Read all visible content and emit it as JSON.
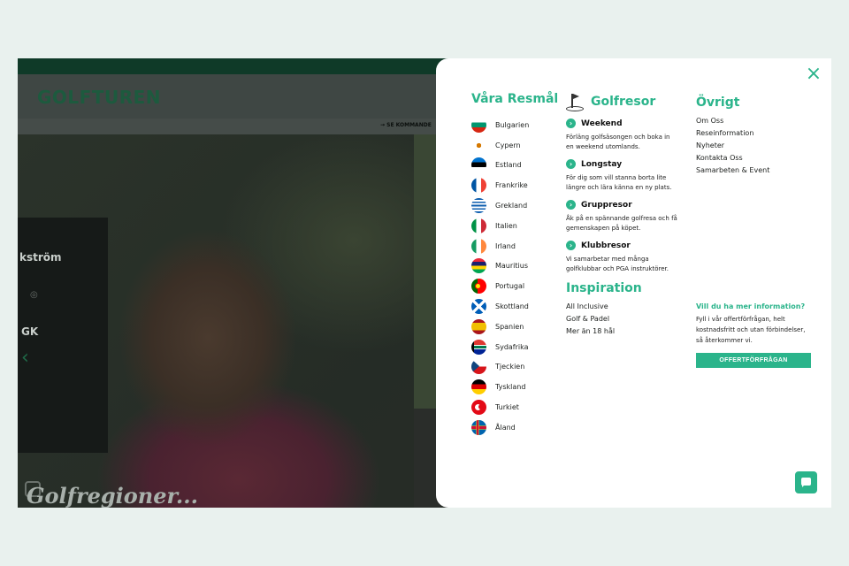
{
  "site": {
    "logo": "GOLFTUREN",
    "subbar_link": "→ SE KOMMANDE",
    "card_name": "kström",
    "card_gk": "GK",
    "regions_title": "Golfregioner..."
  },
  "menu": {
    "destinations_title": "Våra Resmål",
    "destinations": [
      {
        "label": "Bulgarien",
        "flag": "bulgaria"
      },
      {
        "label": "Cypern",
        "flag": "cyprus"
      },
      {
        "label": "Estland",
        "flag": "estonia"
      },
      {
        "label": "Frankrike",
        "flag": "france"
      },
      {
        "label": "Grekland",
        "flag": "greece"
      },
      {
        "label": "Italien",
        "flag": "italy"
      },
      {
        "label": "Irland",
        "flag": "ireland"
      },
      {
        "label": "Mauritius",
        "flag": "mauritius"
      },
      {
        "label": "Portugal",
        "flag": "portugal"
      },
      {
        "label": "Skottland",
        "flag": "scotland"
      },
      {
        "label": "Spanien",
        "flag": "spain"
      },
      {
        "label": "Sydafrika",
        "flag": "southafrica"
      },
      {
        "label": "Tjeckien",
        "flag": "czech"
      },
      {
        "label": "Tyskland",
        "flag": "germany"
      },
      {
        "label": "Turkiet",
        "flag": "turkey"
      },
      {
        "label": "Åland",
        "flag": "aland"
      }
    ],
    "golfresor_title": "Golfresor",
    "golfresor": [
      {
        "title": "Weekend",
        "desc": "Förläng golfsäsongen och boka in en weekend utomlands."
      },
      {
        "title": "Longstay",
        "desc": "För dig som vill stanna borta lite längre och lära känna en ny plats."
      },
      {
        "title": "Gruppresor",
        "desc": "Åk på en spännande golfresa och få gemenskapen på köpet."
      },
      {
        "title": "Klubbresor",
        "desc": "Vi samarbetar med många golfklubbar och PGA instruktörer."
      }
    ],
    "inspiration_title": "Inspiration",
    "inspiration": [
      "All Inclusive",
      "Golf & Padel",
      "Mer än 18 hål"
    ],
    "ovrigt_title": "Övrigt",
    "ovrigt": [
      "Om Oss",
      "Reseinformation",
      "Nyheter",
      "Kontakta Oss",
      "Samarbeten & Event"
    ],
    "info_title": "Vill du ha mer information?",
    "info_text": "Fyll i vår offertförfrågan, helt kostnadsfritt och utan förbindelser, så återkommer vi.",
    "cta_label": "OFFERTFÖRFRÅGAN",
    "close_icon": "×"
  },
  "colors": {
    "accent": "#2bb48b",
    "dark_green": "#0f3a28"
  }
}
